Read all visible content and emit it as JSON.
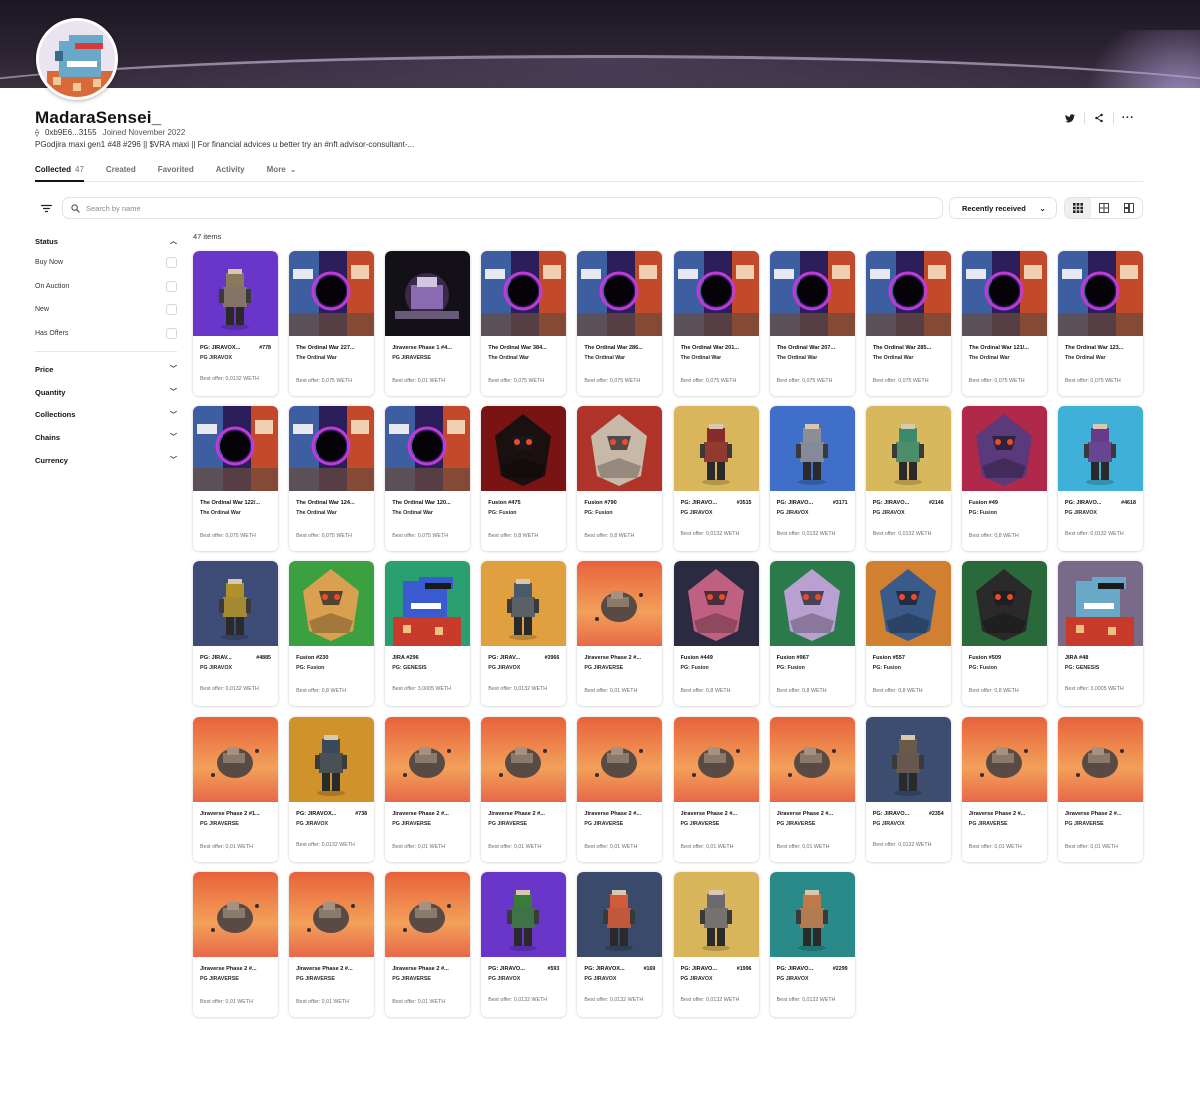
{
  "profile": {
    "name": "MadaraSensei_",
    "address": "0xb9E6...3155",
    "joined": "Joined November 2022",
    "bio": "PGodjira maxi gen1 #48 #296 || $VRA maxi || For financial advices u better try an #nft advisor-consultant-..."
  },
  "tabs": [
    {
      "label": "Collected",
      "count": "47"
    },
    {
      "label": "Created",
      "count": ""
    },
    {
      "label": "Favorited",
      "count": ""
    },
    {
      "label": "Activity",
      "count": ""
    },
    {
      "label": "More",
      "count": ""
    }
  ],
  "search": {
    "placeholder": "Search by name"
  },
  "sort": {
    "label": "Recently received"
  },
  "sidebar": {
    "status_title": "Status",
    "status_options": [
      "Buy Now",
      "On Auction",
      "New",
      "Has Offers"
    ],
    "sections": [
      "Price",
      "Quantity",
      "Collections",
      "Chains",
      "Currency"
    ]
  },
  "items_count": "47 items",
  "colors": {
    "accent": "#121212",
    "banner": "#241c2a"
  },
  "items": [
    {
      "name": "PG: JIRAVOX...",
      "num": "#778",
      "coll": "PG JIRAVOX",
      "offer": "Best offer: 0,0132 WETH",
      "art": "vox",
      "bg": "#6a36c9",
      "fg": "#8a7a5c"
    },
    {
      "name": "The Ordinal War 227...",
      "num": "",
      "coll": "The Ordinal War",
      "offer": "Best offer: 0,075 WETH",
      "art": "war"
    },
    {
      "name": "Jiraverse Phase 1 #4...",
      "num": "",
      "coll": "PG JIRAVERSE",
      "offer": "Best offer: 0,01 WETH",
      "art": "dark"
    },
    {
      "name": "The Ordinal War 384...",
      "num": "",
      "coll": "The Ordinal War",
      "offer": "Best offer: 0,075 WETH",
      "art": "war"
    },
    {
      "name": "The Ordinal War 286...",
      "num": "",
      "coll": "The Ordinal War",
      "offer": "Best offer: 0,075 WETH",
      "art": "war"
    },
    {
      "name": "The Ordinal War 201...",
      "num": "",
      "coll": "The Ordinal War",
      "offer": "Best offer: 0,075 WETH",
      "art": "war"
    },
    {
      "name": "The Ordinal War 207...",
      "num": "",
      "coll": "The Ordinal War",
      "offer": "Best offer: 0,075 WETH",
      "art": "war"
    },
    {
      "name": "The Ordinal War 285...",
      "num": "",
      "coll": "The Ordinal War",
      "offer": "Best offer: 0,075 WETH",
      "art": "war"
    },
    {
      "name": "The Ordinal War 121/...",
      "num": "",
      "coll": "The Ordinal War",
      "offer": "Best offer: 0,075 WETH",
      "art": "war"
    },
    {
      "name": "The Ordinal War 123...",
      "num": "",
      "coll": "The Ordinal War",
      "offer": "Best offer: 0,075 WETH",
      "art": "war"
    },
    {
      "name": "The Ordinal War 122/...",
      "num": "",
      "coll": "The Ordinal War",
      "offer": "Best offer: 0,075 WETH",
      "art": "war"
    },
    {
      "name": "The Ordinal War 124...",
      "num": "",
      "coll": "The Ordinal War",
      "offer": "Best offer: 0,075 WETH",
      "art": "war"
    },
    {
      "name": "The Ordinal War 120...",
      "num": "",
      "coll": "The Ordinal War",
      "offer": "Best offer: 0,075 WETH",
      "art": "war"
    },
    {
      "name": "Fusion #475",
      "num": "",
      "coll": "PG: Fusion",
      "offer": "Best offer: 0,8 WETH",
      "art": "fusion",
      "bg": "#7a1414",
      "fg": "#1a1010"
    },
    {
      "name": "Fusion #790",
      "num": "",
      "coll": "PG: Fusion",
      "offer": "Best offer: 0,8 WETH",
      "art": "fusion",
      "bg": "#b0332a",
      "fg": "#c8b8a8"
    },
    {
      "name": "PG: JIRAVO...",
      "num": "#3515",
      "coll": "PG JIRAVOX",
      "offer": "Best offer: 0,0132 WETH",
      "art": "vox",
      "bg": "#d9b55c",
      "fg": "#8a2b2b"
    },
    {
      "name": "PG: JIRAVO...",
      "num": "#3171",
      "coll": "PG JIRAVOX",
      "offer": "Best offer: 0,0132 WETH",
      "art": "vox",
      "bg": "#3f6fc8",
      "fg": "#8d8d95"
    },
    {
      "name": "PG: JIRAVO...",
      "num": "#2146",
      "coll": "PG JIRAVOX",
      "offer": "Best offer: 0,0132 WETH",
      "art": "vox",
      "bg": "#d8b85c",
      "fg": "#3d8a6a"
    },
    {
      "name": "Fusion #49",
      "num": "",
      "coll": "PG: Fusion",
      "offer": "Best offer: 0,8 WETH",
      "art": "fusion",
      "bg": "#b0284a",
      "fg": "#5a3a7a"
    },
    {
      "name": "PG: JIRAVO...",
      "num": "#4618",
      "coll": "PG JIRAVOX",
      "offer": "Best offer: 0,0132 WETH",
      "art": "vox",
      "bg": "#3fb0d8",
      "fg": "#6a3a8a"
    },
    {
      "name": "PG: JIRAV...",
      "num": "#4885",
      "coll": "PG JIRAVOX",
      "offer": "Best offer: 0,0132 WETH",
      "art": "vox",
      "bg": "#3d4d78",
      "fg": "#b0902a"
    },
    {
      "name": "Fusion #230",
      "num": "",
      "coll": "PG: Fusion",
      "offer": "Best offer: 0,8 WETH",
      "art": "fusion",
      "bg": "#3aa040",
      "fg": "#d8a050"
    },
    {
      "name": "JIRA #296",
      "num": "",
      "coll": "PG: GENESIS",
      "offer": "Best offer: 3,0005 WETH",
      "art": "pixel",
      "bg": "#2aa070",
      "fg": "#3a5ad0"
    },
    {
      "name": "PG: JIRAV...",
      "num": "#3966",
      "coll": "PG JIRAVOX",
      "offer": "Best offer: 0,0132 WETH",
      "art": "vox",
      "bg": "#e0a040",
      "fg": "#4a5a6a"
    },
    {
      "name": "Jiraverse Phase 2 #...",
      "num": "",
      "coll": "PG JIRAVERSE",
      "offer": "Best offer: 0,01 WETH",
      "art": "sunset"
    },
    {
      "name": "Fusion #449",
      "num": "",
      "coll": "PG: Fusion",
      "offer": "Best offer: 0,8 WETH",
      "art": "fusion",
      "bg": "#2a2a40",
      "fg": "#c06080"
    },
    {
      "name": "Fusion #967",
      "num": "",
      "coll": "PG: Fusion",
      "offer": "Best offer: 0,8 WETH",
      "art": "fusion",
      "bg": "#2a7a4a",
      "fg": "#b8a0d0"
    },
    {
      "name": "Fusion #557",
      "num": "",
      "coll": "PG: Fusion",
      "offer": "Best offer: 0,8 WETH",
      "art": "fusion",
      "bg": "#d08030",
      "fg": "#3a5a8a"
    },
    {
      "name": "Fusion #509",
      "num": "",
      "coll": "PG: Fusion",
      "offer": "Best offer: 0,8 WETH",
      "art": "fusion",
      "bg": "#2a6a3a",
      "fg": "#2a2a2a"
    },
    {
      "name": "JIRA #48",
      "num": "",
      "coll": "PG: GENESIS",
      "offer": "Best offer: 3,0005 WETH",
      "art": "pixel",
      "bg": "#7a6a8a",
      "fg": "#6aa8c8"
    },
    {
      "name": "Jiraverse Phase 2 #1...",
      "num": "",
      "coll": "PG JIRAVERSE",
      "offer": "Best offer: 0,01 WETH",
      "art": "sunset"
    },
    {
      "name": "PG: JIRAVOX...",
      "num": "#738",
      "coll": "PG JIRAVOX",
      "offer": "Best offer: 0,0132 WETH",
      "art": "vox",
      "bg": "#d0922a",
      "fg": "#3a4a5a"
    },
    {
      "name": "Jiraverse Phase 2 #...",
      "num": "",
      "coll": "PG JIRAVERSE",
      "offer": "Best offer: 0,01 WETH",
      "art": "sunset"
    },
    {
      "name": "Jiraverse Phase 2 #...",
      "num": "",
      "coll": "PG JIRAVERSE",
      "offer": "Best offer: 0,01 WETH",
      "art": "sunset"
    },
    {
      "name": "Jiraverse Phase 2 #...",
      "num": "",
      "coll": "PG JIRAVERSE",
      "offer": "Best offer: 0,01 WETH",
      "art": "sunset"
    },
    {
      "name": "Jiraverse Phase 2 #...",
      "num": "",
      "coll": "PG JIRAVERSE",
      "offer": "Best offer: 0,01 WETH",
      "art": "sunset"
    },
    {
      "name": "Jiraverse Phase 2 #...",
      "num": "",
      "coll": "PG JIRAVERSE",
      "offer": "Best offer: 0,01 WETH",
      "art": "sunset"
    },
    {
      "name": "PG: JIRAVO...",
      "num": "#2354",
      "coll": "PG JIRAVOX",
      "offer": "Best offer: 0,0132 WETH",
      "art": "vox",
      "bg": "#3d4d70",
      "fg": "#6a5a4a"
    },
    {
      "name": "Jiraverse Phase 2 #...",
      "num": "",
      "coll": "PG JIRAVERSE",
      "offer": "Best offer: 0,01 WETH",
      "art": "sunset"
    },
    {
      "name": "Jiraverse Phase 2 #...",
      "num": "",
      "coll": "PG JIRAVERSE",
      "offer": "Best offer: 0,01 WETH",
      "art": "sunset"
    },
    {
      "name": "Jiraverse Phase 2 #...",
      "num": "",
      "coll": "PG JIRAVERSE",
      "offer": "Best offer: 0,01 WETH",
      "art": "sunset"
    },
    {
      "name": "Jiraverse Phase 2 #...",
      "num": "",
      "coll": "PG JIRAVERSE",
      "offer": "Best offer: 0,01 WETH",
      "art": "sunset"
    },
    {
      "name": "Jiraverse Phase 2 #...",
      "num": "",
      "coll": "PG JIRAVERSE",
      "offer": "Best offer: 0,01 WETH",
      "art": "sunset"
    },
    {
      "name": "PG: JIRAVO...",
      "num": "#593",
      "coll": "PG JIRAVOX",
      "offer": "Best offer: 0,0132 WETH",
      "art": "vox",
      "bg": "#6a36c9",
      "fg": "#3a7a3a"
    },
    {
      "name": "PG: JIRAVOX...",
      "num": "#169",
      "coll": "PG JIRAVOX",
      "offer": "Best offer: 0,0132 WETH",
      "art": "vox",
      "bg": "#3a4a6a",
      "fg": "#d05a3a"
    },
    {
      "name": "PG: JIRAVO...",
      "num": "#1996",
      "coll": "PG JIRAVOX",
      "offer": "Best offer: 0,0132 WETH",
      "art": "vox",
      "bg": "#d8b45a",
      "fg": "#6a6a70"
    },
    {
      "name": "PG: JIRAVO...",
      "num": "#2299",
      "coll": "PG JIRAVOX",
      "offer": "Best offer: 0,0132 WETH",
      "art": "vox",
      "bg": "#2a8a8a",
      "fg": "#c07a4a"
    }
  ]
}
